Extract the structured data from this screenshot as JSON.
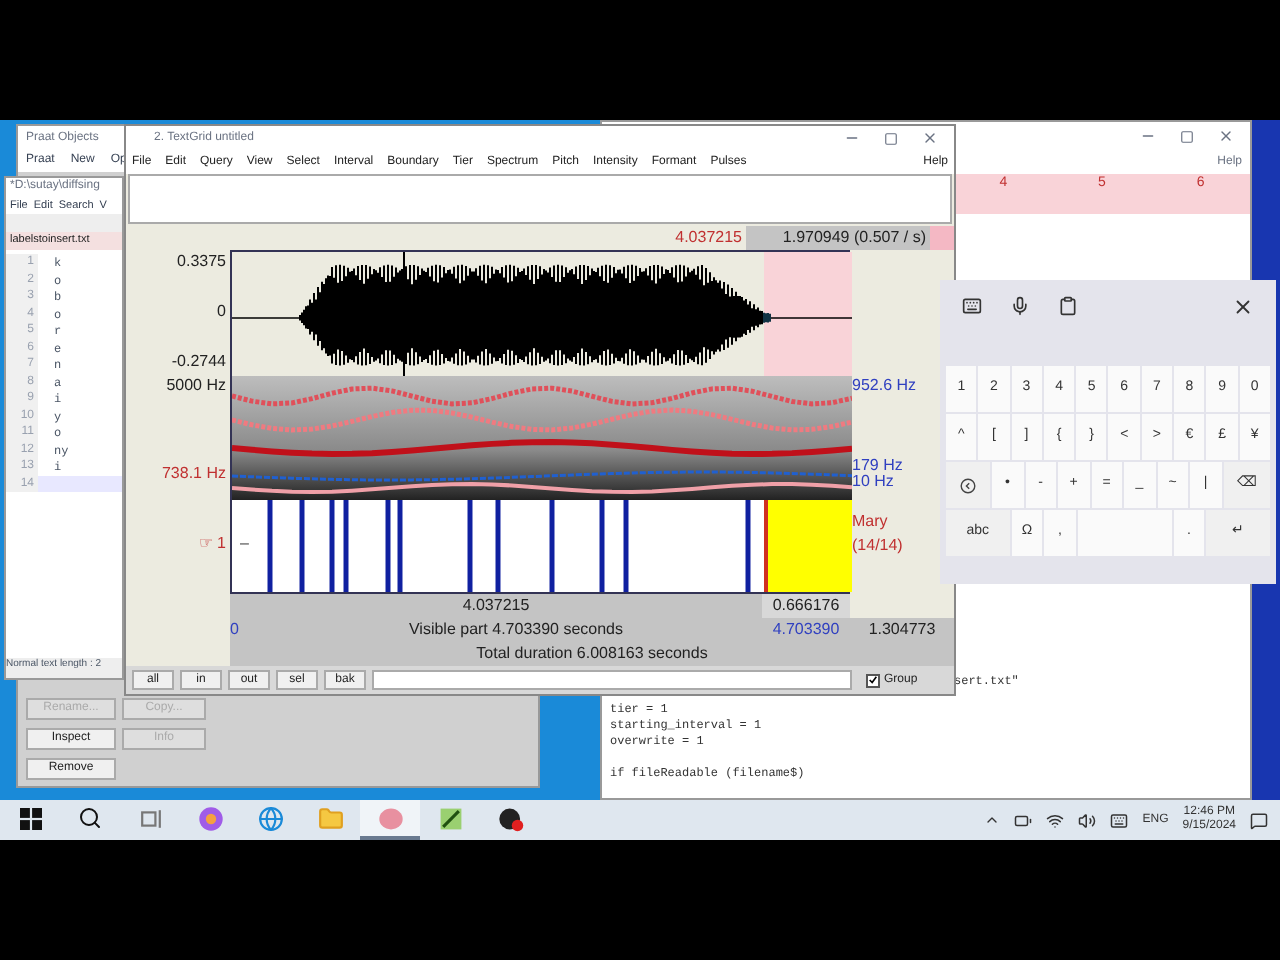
{
  "objects_window": {
    "title": "Praat Objects",
    "menu": [
      "Praat",
      "New",
      "Op"
    ],
    "buttons": [
      {
        "label": "Rename...",
        "disabled": true
      },
      {
        "label": "Copy...",
        "disabled": true
      },
      {
        "label": "Inspect",
        "disabled": false
      },
      {
        "label": "Info",
        "disabled": true
      },
      {
        "label": "Remove",
        "disabled": false
      }
    ]
  },
  "notepad": {
    "title": "*D:\\sutay\\diffsing",
    "menu": [
      "File",
      "Edit",
      "Search",
      "V"
    ],
    "tab": "labelstoinsert.txt",
    "status": "Normal text length : 2",
    "lines": [
      {
        "number": "1",
        "text": "k",
        "selected": false
      },
      {
        "number": "2",
        "text": "o",
        "selected": false
      },
      {
        "number": "3",
        "text": "b",
        "selected": false
      },
      {
        "number": "4",
        "text": "o",
        "selected": false
      },
      {
        "number": "5",
        "text": "r",
        "selected": false
      },
      {
        "number": "6",
        "text": "e",
        "selected": false
      },
      {
        "number": "7",
        "text": "n",
        "selected": false
      },
      {
        "number": "8",
        "text": "a",
        "selected": false
      },
      {
        "number": "9",
        "text": "i",
        "selected": false
      },
      {
        "number": "10",
        "text": "y",
        "selected": false
      },
      {
        "number": "11",
        "text": "o",
        "selected": false
      },
      {
        "number": "12",
        "text": "ny",
        "selected": false
      },
      {
        "number": "13",
        "text": "i",
        "selected": false
      },
      {
        "number": "14",
        "selected": true
      }
    ]
  },
  "picture_window": {
    "menu": [
      "Help"
    ],
    "ruler": [
      "4",
      "5",
      "6"
    ]
  },
  "script_editor": {
    "blocks": [
      [
        "sert.txt\"",
        "tier = 1",
        "starting_interval = 1",
        "overwrite = 1"
      ],
      [
        "if fileReadable (filename$)"
      ]
    ]
  },
  "textgrid_window": {
    "title": "2. TextGrid untitled",
    "menu": [
      "File",
      "Edit",
      "Query",
      "View",
      "Select",
      "Interval",
      "Boundary",
      "Tier",
      "Spectrum",
      "Pitch",
      "Intensity",
      "Formant",
      "Pulses"
    ],
    "help": "Help",
    "cursor_time": "4.037215",
    "selection_info": "1.970949 (0.507 / s)",
    "waveform": {
      "max": "0.3375",
      "zero": "0",
      "min": "-0.2744"
    },
    "spectrogram": {
      "top": "5000 Hz",
      "cursor": "738.1 Hz",
      "right_top": "952.6 Hz",
      "pitch_top": "179 Hz",
      "pitch_bottom": "10 Hz"
    },
    "tier": {
      "pointer": "☞",
      "number": "1",
      "first_label": "–",
      "selected_label": "Mary",
      "count": "(14/14)"
    },
    "time_row": {
      "cursor": "4.037215",
      "selection": "0.666176"
    },
    "visible_row": {
      "start": "0",
      "label": "Visible part 4.703390 seconds",
      "end": "4.703390",
      "tail": "1.304773"
    },
    "total": "Total duration 6.008163 seconds",
    "buttons": [
      "all",
      "in",
      "out",
      "sel",
      "bak"
    ],
    "group": {
      "label": "Group",
      "checked": true
    }
  },
  "touch_keyboard": {
    "rows": [
      {
        "keys": [
          {
            "kind": "char",
            "label": "1"
          },
          {
            "kind": "char",
            "label": "2"
          },
          {
            "kind": "char",
            "label": "3"
          },
          {
            "kind": "char",
            "label": "4"
          },
          {
            "kind": "char",
            "label": "5"
          },
          {
            "kind": "char",
            "label": "6"
          },
          {
            "kind": "char",
            "label": "7"
          },
          {
            "kind": "char",
            "label": "8"
          },
          {
            "kind": "char",
            "label": "9"
          },
          {
            "kind": "char",
            "label": "0"
          }
        ]
      },
      {
        "keys": [
          {
            "kind": "char",
            "label": "^"
          },
          {
            "kind": "char",
            "label": "["
          },
          {
            "kind": "char",
            "label": "]"
          },
          {
            "kind": "char",
            "label": "{"
          },
          {
            "kind": "char",
            "label": "}"
          },
          {
            "kind": "char",
            "label": "<"
          },
          {
            "kind": "char",
            "label": ">"
          },
          {
            "kind": "char",
            "label": "€"
          },
          {
            "kind": "char",
            "label": "£"
          },
          {
            "kind": "char",
            "label": "¥"
          }
        ]
      },
      {
        "keys": [
          {
            "kind": "back"
          },
          {
            "kind": "char",
            "label": "•"
          },
          {
            "kind": "char",
            "label": "-"
          },
          {
            "kind": "char",
            "label": "+"
          },
          {
            "kind": "char",
            "label": "="
          },
          {
            "kind": "char",
            "label": "_"
          },
          {
            "kind": "char",
            "label": "~"
          },
          {
            "kind": "char",
            "label": "|"
          },
          {
            "kind": "wide",
            "label": "⌫"
          }
        ]
      },
      {
        "keys": [
          {
            "kind": "wide",
            "label": "abc"
          },
          {
            "kind": "char",
            "label": "Ω"
          },
          {
            "kind": "char",
            "label": ","
          },
          {
            "kind": "space"
          },
          {
            "kind": "char",
            "label": "."
          },
          {
            "kind": "wide",
            "label": "↵"
          }
        ]
      }
    ]
  },
  "taskbar": {
    "apps": [
      {
        "kind": "start",
        "selected": false
      },
      {
        "kind": "search",
        "selected": false
      },
      {
        "kind": "taskview",
        "selected": false
      },
      {
        "kind": "copilot",
        "selected": false
      },
      {
        "kind": "edge",
        "selected": false
      },
      {
        "kind": "folder",
        "selected": false
      },
      {
        "kind": "praat",
        "selected": true
      },
      {
        "kind": "notepad",
        "selected": false
      },
      {
        "kind": "record",
        "selected": false
      }
    ],
    "language": "ENG",
    "time": "12:46 PM",
    "date": "9/15/2024"
  }
}
